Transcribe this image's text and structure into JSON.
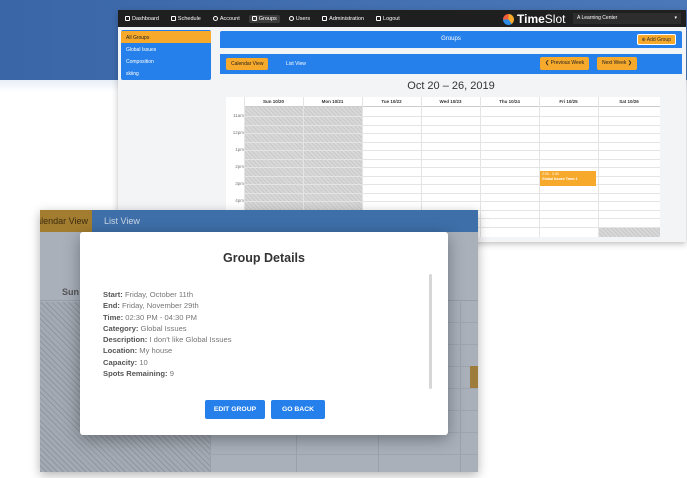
{
  "nav": {
    "items": [
      {
        "label": "Dashboard",
        "icon": "grid-icon"
      },
      {
        "label": "Schedule",
        "icon": "calendar-icon"
      },
      {
        "label": "Account",
        "icon": "user-circle-icon"
      },
      {
        "label": "Groups",
        "icon": "groups-icon"
      },
      {
        "label": "Users",
        "icon": "users-icon"
      },
      {
        "label": "Administration",
        "icon": "admin-icon"
      },
      {
        "label": "Logout",
        "icon": "logout-icon"
      }
    ],
    "brand_bold": "Time",
    "brand_light": "Slot",
    "center_select": "A Learning Center",
    "center_select_caret": "▾"
  },
  "sidebar": {
    "items": [
      "All Groups",
      "Global Issues",
      "Composition",
      "skiing"
    ]
  },
  "groups_panel": {
    "title": "Groups",
    "add_button": "⊕ Add Group"
  },
  "calendar": {
    "calendar_view_btn": "Calendar View",
    "list_view_btn": "List View",
    "prev_week": "❮ Previous Week",
    "next_week": "Next Week ❯",
    "range": "Oct 20 – 26, 2019",
    "days": [
      "Sun 10/20",
      "Mon 10/21",
      "Tue 10/22",
      "Wed 10/23",
      "Thu 10/24",
      "Fri 10/25",
      "Sat 10/26"
    ],
    "times": [
      "11am",
      "12pm",
      "1pm",
      "2pm",
      "3pm",
      "4pm"
    ],
    "event": {
      "time": "2:30 - 3:30",
      "title": "Global Issues Team 1"
    }
  },
  "front": {
    "calendar_view": "Calendar View",
    "list_view": "List View",
    "sun_label": "Sun"
  },
  "modal": {
    "title": "Group Details",
    "details": [
      {
        "label": "Start:",
        "value": "Friday, October 11th"
      },
      {
        "label": "End:",
        "value": "Friday, November 29th"
      },
      {
        "label": "Time:",
        "value": "02:30 PM - 04:30 PM"
      },
      {
        "label": "Category:",
        "value": "Global Issues"
      },
      {
        "label": "Description:",
        "value": "I don't like Global Issues"
      },
      {
        "label": "Location:",
        "value": "My house"
      },
      {
        "label": "Capacity:",
        "value": "10"
      },
      {
        "label": "Spots Remaining:",
        "value": "9"
      }
    ],
    "edit_button": "EDIT GROUP",
    "back_button": "GO BACK"
  }
}
